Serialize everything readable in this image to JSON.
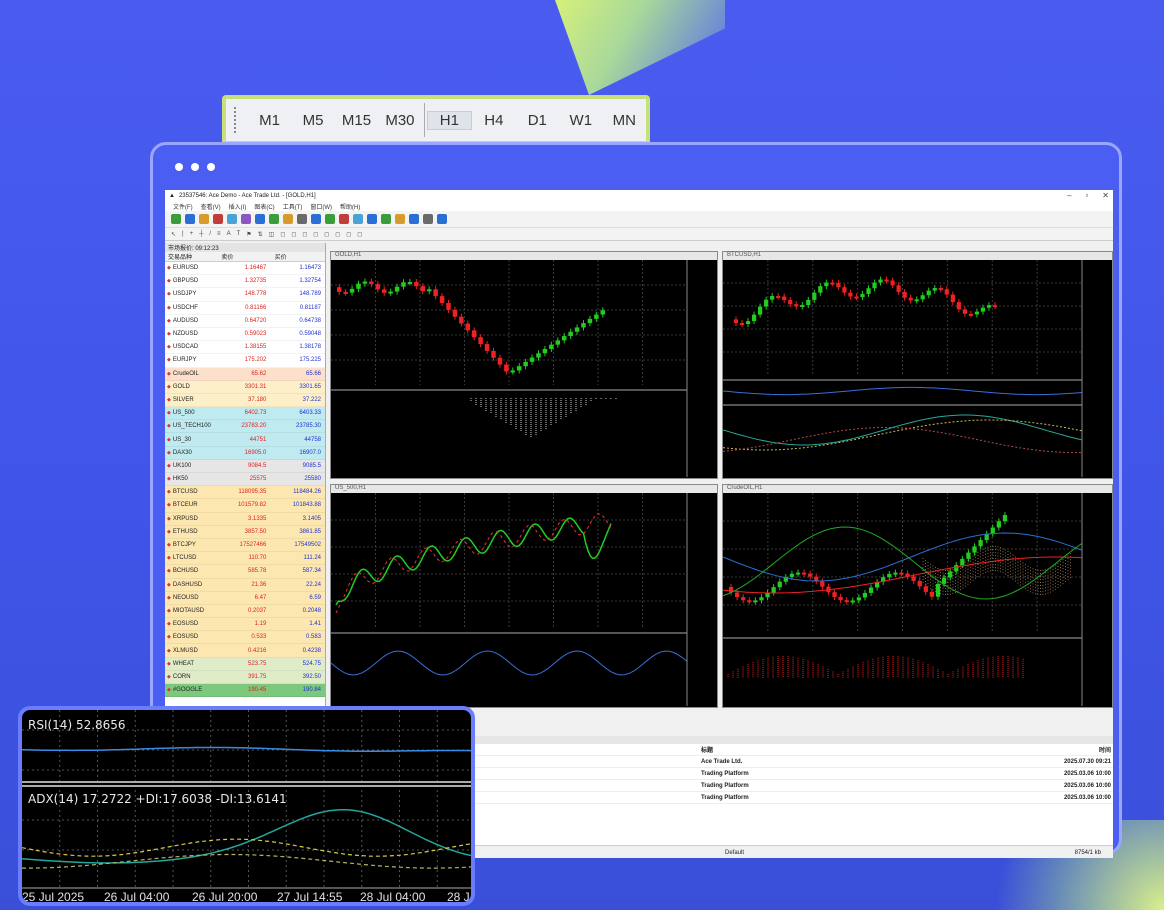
{
  "timeframes": [
    "M1",
    "M5",
    "M15",
    "M30",
    "H1",
    "H4",
    "D1",
    "W1",
    "MN"
  ],
  "active_timeframe": "H1",
  "window": {
    "title": "23537546: Ace Demo - Ace Trade Ltd. - [GOLD,H1]",
    "menu": [
      "文件(F)",
      "查看(V)",
      "插入(I)",
      "图表(C)",
      "工具(T)",
      "窗口(W)",
      "帮助(H)"
    ]
  },
  "market_watch": {
    "header": "市场报价: 09:12:23",
    "columns": [
      "交易品种",
      "卖价",
      "买价"
    ],
    "rows": [
      {
        "symbol": "EURUSD",
        "bid": "1.16467",
        "ask": "1.16473",
        "bg": "#ffffff"
      },
      {
        "symbol": "GBPUSD",
        "bid": "1.32735",
        "ask": "1.32754",
        "bg": "#ffffff"
      },
      {
        "symbol": "USDJPY",
        "bid": "148.778",
        "ask": "148.789",
        "bg": "#ffffff"
      },
      {
        "symbol": "USDCHF",
        "bid": "0.81166",
        "ask": "0.81187",
        "bg": "#ffffff"
      },
      {
        "symbol": "AUDUSD",
        "bid": "0.64720",
        "ask": "0.64738",
        "bg": "#ffffff"
      },
      {
        "symbol": "NZDUSD",
        "bid": "0.59023",
        "ask": "0.59048",
        "bg": "#ffffff"
      },
      {
        "symbol": "USDCAD",
        "bid": "1.38155",
        "ask": "1.38178",
        "bg": "#ffffff"
      },
      {
        "symbol": "EURJPY",
        "bid": "175.202",
        "ask": "175.225",
        "bg": "#ffffff"
      },
      {
        "symbol": "CrudeOIL",
        "bid": "65.62",
        "ask": "65.66",
        "bg": "#fde0cc"
      },
      {
        "symbol": "GOLD",
        "bid": "3301.31",
        "ask": "3301.65",
        "bg": "#fdf0c8"
      },
      {
        "symbol": "SILVER",
        "bid": "37.180",
        "ask": "37.222",
        "bg": "#fdf0c8"
      },
      {
        "symbol": "US_500",
        "bid": "6402.73",
        "ask": "6403.33",
        "bg": "#bfeaf0"
      },
      {
        "symbol": "US_TECH100",
        "bid": "23783.20",
        "ask": "23785.30",
        "bg": "#bfeaf0"
      },
      {
        "symbol": "US_30",
        "bid": "44751",
        "ask": "44758",
        "bg": "#bfeaf0"
      },
      {
        "symbol": "DAX30",
        "bid": "16905.0",
        "ask": "16907.0",
        "bg": "#bfeaf0"
      },
      {
        "symbol": "UK100",
        "bid": "9084.5",
        "ask": "9085.5",
        "bg": "#e6e6e6"
      },
      {
        "symbol": "HK50",
        "bid": "25575",
        "ask": "25580",
        "bg": "#e6e6e6"
      },
      {
        "symbol": "BTCUSD",
        "bid": "118095.35",
        "ask": "118484.26",
        "bg": "#fde7b0"
      },
      {
        "symbol": "BTCEUR",
        "bid": "101579.82",
        "ask": "101843.88",
        "bg": "#fde7b0"
      },
      {
        "symbol": "XRPUSD",
        "bid": "3.1335",
        "ask": "3.1405",
        "bg": "#fde7b0"
      },
      {
        "symbol": "ETHUSD",
        "bid": "3857.50",
        "ask": "3861.85",
        "bg": "#fde7b0"
      },
      {
        "symbol": "BTCJPY",
        "bid": "17527466",
        "ask": "17549502",
        "bg": "#fde7b0"
      },
      {
        "symbol": "LTCUSD",
        "bid": "110.70",
        "ask": "111.24",
        "bg": "#fde7b0"
      },
      {
        "symbol": "BCHUSD",
        "bid": "585.78",
        "ask": "587.34",
        "bg": "#fde7b0"
      },
      {
        "symbol": "DASHUSD",
        "bid": "21.36",
        "ask": "22.24",
        "bg": "#fde7b0"
      },
      {
        "symbol": "NEOUSD",
        "bid": "6.47",
        "ask": "6.59",
        "bg": "#fde7b0"
      },
      {
        "symbol": "MIOTAUSD",
        "bid": "0.2037",
        "ask": "0.2048",
        "bg": "#fde7b0"
      },
      {
        "symbol": "EOSUSD",
        "bid": "1.19",
        "ask": "1.41",
        "bg": "#fde7b0"
      },
      {
        "symbol": "EOSUSD",
        "bid": "0.533",
        "ask": "0.583",
        "bg": "#fde7b0"
      },
      {
        "symbol": "XLMUSD",
        "bid": "0.4216",
        "ask": "0.4238",
        "bg": "#fde7b0"
      },
      {
        "symbol": "WHEAT",
        "bid": "523.75",
        "ask": "524.75",
        "bg": "#e0ecc8"
      },
      {
        "symbol": "CORN",
        "bid": "391.75",
        "ask": "392.50",
        "bg": "#e0ecc8"
      },
      {
        "symbol": "#GOOGLE",
        "bid": "190.45",
        "ask": "190.84",
        "bg": "#7cc87c"
      }
    ]
  },
  "charts": [
    {
      "id": "gold",
      "title": "GOLD,H1"
    },
    {
      "id": "btc",
      "title": "BTCUSD,H1"
    },
    {
      "id": "us500",
      "title": "US_500,H1"
    },
    {
      "id": "oil",
      "title": "CrudeOIL,H1"
    }
  ],
  "terminal": {
    "columns": [
      "",
      "标题",
      "时间"
    ],
    "rows": [
      {
        "from": "",
        "subject": "Ace Trade Ltd.",
        "time": "2025.07.30 09:21"
      },
      {
        "from": "",
        "subject": "Trading Platform",
        "time": "2025.03.06 10:00"
      },
      {
        "from": "",
        "subject": "Trading Platform",
        "time": "2025.03.06 10:00"
      },
      {
        "from": "",
        "subject": "Trading Platform",
        "time": "2025.03.06 10:00"
      }
    ]
  },
  "status": {
    "profile": "Default",
    "traffic": "8754/1 kb"
  },
  "zoom_indicators": {
    "rsi": "RSI(14) 52.8656",
    "adx": "ADX(14) 17.2722  +DI:17.6038  -DI:13.6141",
    "x_ticks": [
      "25 Jul 2025",
      "26 Jul 04:00",
      "26 Jul 20:00",
      "27 Jul 14:55",
      "28 Jul 04:00",
      "28 J"
    ]
  },
  "colors": {
    "accent": "#4a5cf0",
    "frame": "#c8e07a",
    "bull": "#22cc22",
    "bear": "#ee2222"
  }
}
